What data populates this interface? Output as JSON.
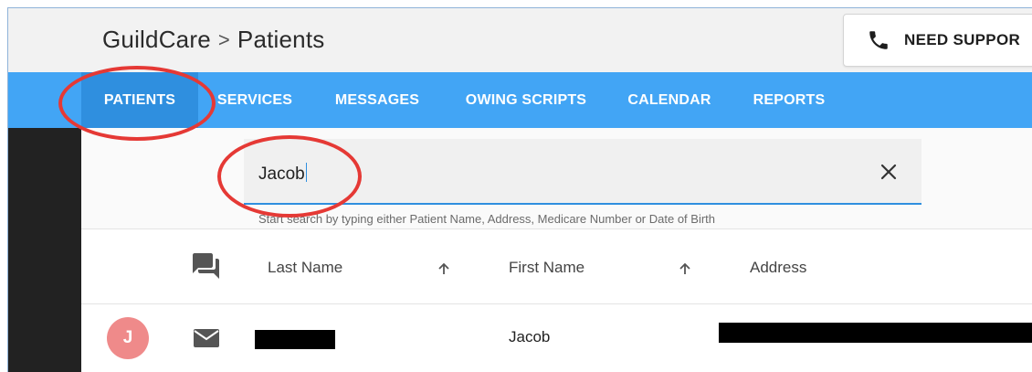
{
  "header": {
    "breadcrumb": [
      "GuildCare",
      "Patients"
    ],
    "separator": ">",
    "support_button_label": "NEED SUPPOR"
  },
  "nav": {
    "tabs": [
      {
        "label": "PATIENTS",
        "active": true
      },
      {
        "label": "SERVICES",
        "active": false
      },
      {
        "label": "MESSAGES",
        "active": false
      },
      {
        "label": "OWING SCRIPTS",
        "active": false
      },
      {
        "label": "CALENDAR",
        "active": false
      },
      {
        "label": "REPORTS",
        "active": false
      }
    ]
  },
  "search": {
    "value": "Jacob",
    "hint": "Start search by typing either Patient Name, Address, Medicare Number or Date of Birth"
  },
  "table": {
    "columns": [
      "Last Name",
      "First Name",
      "Address"
    ],
    "rows": [
      {
        "avatar_initial": "J",
        "first_name": "Jacob"
      }
    ]
  },
  "icons": {
    "support": "phone-icon",
    "clear": "close-icon",
    "messages_column": "chat-icon",
    "row_message": "mail-icon",
    "sort": "arrow-up-icon"
  },
  "colors": {
    "navbar": "#42a5f5",
    "nav_active": "#2f8fdf",
    "annotation": "#e53935",
    "avatar": "#ef8a8a",
    "sidebar": "#222222"
  }
}
